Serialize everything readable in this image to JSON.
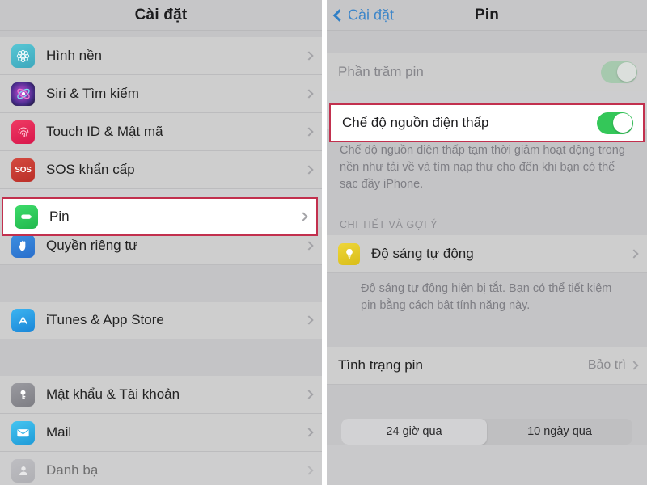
{
  "left_screen": {
    "nav": {
      "title": "Cài đặt"
    },
    "groups": [
      {
        "items": [
          {
            "label": "Hình nền",
            "icon": "wallpaper-icon",
            "color": "#4cb6c7"
          },
          {
            "label": "Siri & Tìm kiếm",
            "icon": "siri-icon",
            "color": "#1c1c2e"
          },
          {
            "label": "Touch ID & Mật mã",
            "icon": "touch-id-icon",
            "color": "#e8315c"
          },
          {
            "label": "SOS khẩn cấp",
            "icon": "sos-icon",
            "color": "#c83b34"
          },
          {
            "label": "Pin",
            "icon": "battery-icon",
            "color": "#34c759",
            "highlighted": true
          },
          {
            "label": "Quyền riêng tư",
            "icon": "privacy-hand-icon",
            "color": "#2f7fd8"
          }
        ]
      },
      {
        "items": [
          {
            "label": "iTunes & App Store",
            "icon": "app-store-icon",
            "color": "#2aa3e8"
          }
        ]
      },
      {
        "items": [
          {
            "label": "Mật khẩu & Tài khoản",
            "icon": "key-icon",
            "color": "#8e8e93"
          },
          {
            "label": "Mail",
            "icon": "mail-icon",
            "color": "#35b7e8"
          },
          {
            "label": "Danh bạ",
            "icon": "contacts-icon",
            "color": "#9a9aa0"
          }
        ]
      }
    ]
  },
  "right_screen": {
    "nav": {
      "back_label": "Cài đặt",
      "title": "Pin"
    },
    "rows": [
      {
        "label": "Phần trăm pin",
        "toggle": "off-dim"
      },
      {
        "label": "Chế độ nguồn điện thấp",
        "toggle": "on",
        "highlighted": true
      }
    ],
    "low_power_footnote": "Chế độ nguồn điện thấp tạm thời giảm hoạt động trong nền như tải về và tìm nạp thư cho đến khi bạn có thể sạc đầy iPhone.",
    "section_header": "CHI TIẾT VÀ GỢI Ý",
    "auto_brightness": {
      "label": "Độ sáng tự động",
      "icon": "lightbulb-icon",
      "color": "#e8c92a"
    },
    "auto_brightness_footnote": "Độ sáng tự động hiện bị tắt. Bạn có thể tiết kiệm pin bằng cách bật tính năng này.",
    "battery_health": {
      "label": "Tình trạng pin",
      "value": "Bảo trì"
    },
    "segments": [
      {
        "label": "24 giờ qua",
        "selected": true
      },
      {
        "label": "10 ngày qua",
        "selected": false
      }
    ]
  },
  "theme": {
    "accent_blue": "#3e86c9",
    "toggle_green": "#34c759",
    "highlight_red": "#c2304e"
  }
}
